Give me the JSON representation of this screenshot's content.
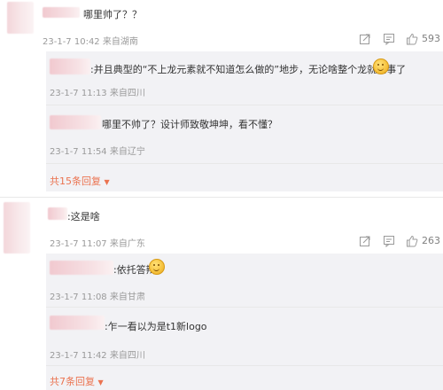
{
  "comments": [
    {
      "text": "哪里帅了？？",
      "time": "23-1-7 10:42 来自湖南",
      "likes": "593",
      "replies": [
        {
          "text": "并且典型的“不上龙元素就不知道怎么做的”地步，无论啥整个龙就完事了",
          "time": "23-1-7 11:13 来自四川"
        },
        {
          "text": "哪里不帅了？设计师致敬坤坤，看不懂？",
          "time": "23-1-7 11:54 来自辽宁"
        }
      ],
      "more_label": "共15条回复"
    },
    {
      "text": "这是啥",
      "time": "23-1-7 11:07 来自广东",
      "likes": "263",
      "replies": [
        {
          "text": "依托答辩",
          "time": "23-1-7 11:08 来自甘肃"
        },
        {
          "text": "乍一看以为是t1新logo",
          "time": "23-1-7 11:42 来自四川"
        }
      ],
      "more_label": "共7条回复"
    }
  ],
  "icons": {
    "share": "share-icon",
    "comment": "comment-icon",
    "like": "thumbs-up-icon",
    "expand": "chevron-down-icon",
    "emoji": "grin-emoji-icon"
  },
  "colors": {
    "accent": "#eb7350",
    "meta_text": "#9a9a9a",
    "reply_bg": "#f2f2f5"
  }
}
